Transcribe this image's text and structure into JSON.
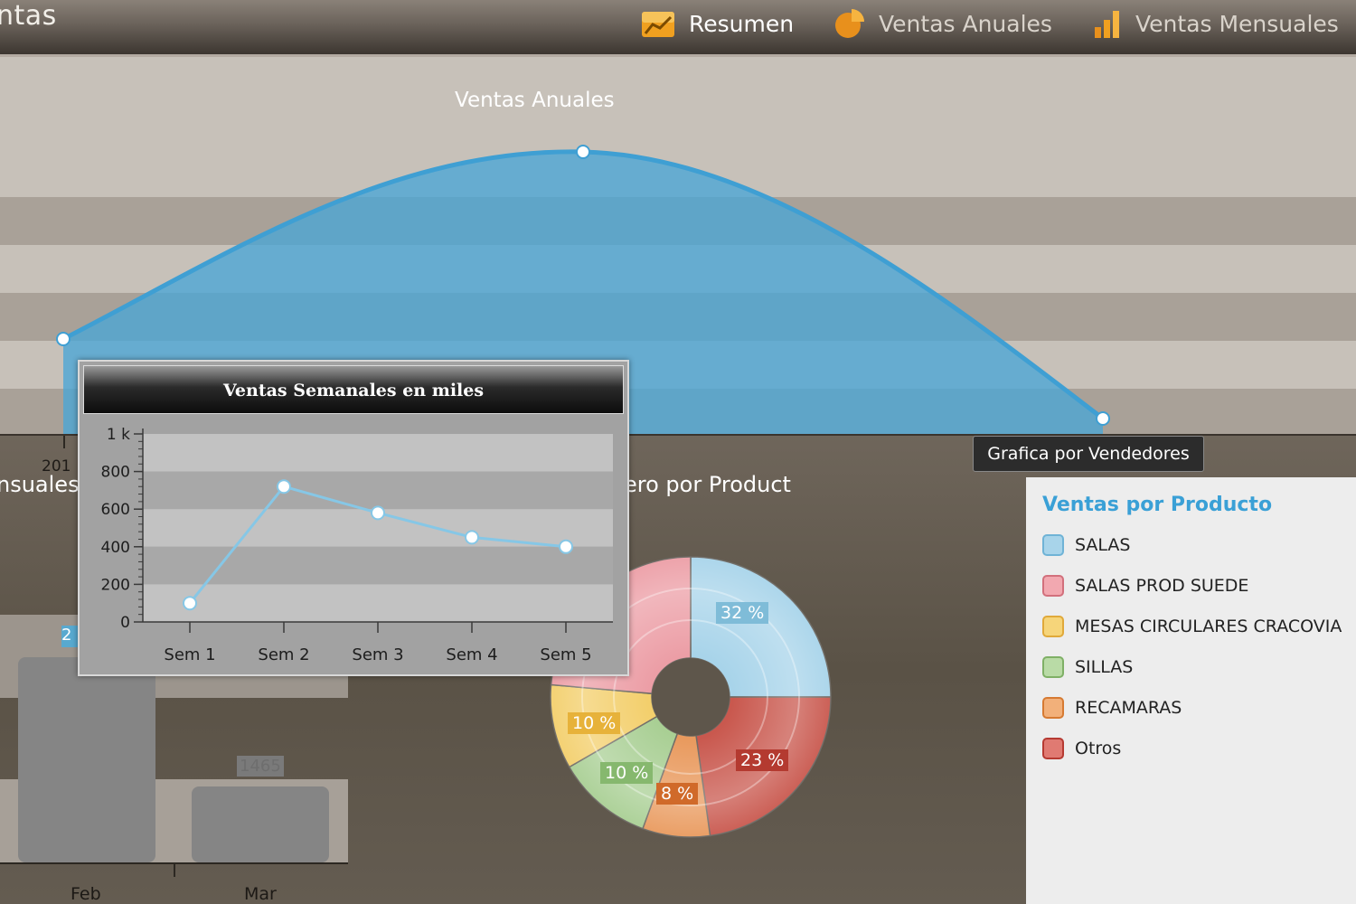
{
  "app": {
    "title_fragment": "ntas"
  },
  "nav": {
    "items": [
      {
        "label": "Resumen",
        "icon": "line-chart-icon",
        "active": true
      },
      {
        "label": "Ventas Anuales",
        "icon": "pie-chart-icon",
        "active": false
      },
      {
        "label": "Ventas Mensuales",
        "icon": "bar-chart-icon",
        "active": false
      }
    ]
  },
  "colors": {
    "accent_orange": "#f0a020",
    "area_blue": "#4aa6d6",
    "legend_title": "#3aa0d6"
  },
  "annual_chart": {
    "title": "Ventas Anuales",
    "year_tick_fragment": "201"
  },
  "partial_titles": {
    "left": "nsuales",
    "center": "ero por Product"
  },
  "monthly_bars": {
    "months": [
      "Feb",
      "Mar"
    ],
    "mar_value_label": "1465",
    "feb_value_label_fragment": "2"
  },
  "tooltip": {
    "text": "Grafica por Vendedores"
  },
  "legend": {
    "title": "Ventas por Producto",
    "items": [
      {
        "label": "SALAS",
        "color": "#a8d4ea",
        "border": "#6fb3d6"
      },
      {
        "label": "SALAS PROD SUEDE",
        "color": "#f2a8b0",
        "border": "#d2707c"
      },
      {
        "label": "MESAS CIRCULARES CRACOVIA",
        "color": "#f6d57a",
        "border": "#e0a93a"
      },
      {
        "label": "SILLAS",
        "color": "#b9dba6",
        "border": "#7fb066"
      },
      {
        "label": "RECAMARAS",
        "color": "#f2b07a",
        "border": "#d67a32"
      },
      {
        "label": "Otros",
        "color": "#e07a72",
        "border": "#b63a32"
      }
    ]
  },
  "donut": {
    "slices": [
      {
        "label": "32 %",
        "color": "#a8d4ea",
        "label_bg": "#7fbcd8"
      },
      {
        "label": "23 %",
        "color": "#c9584e",
        "label_bg": "#b43a30"
      },
      {
        "label": "8 %",
        "color": "#e99a5e",
        "label_bg": "#d06a2a"
      },
      {
        "label": "10 %",
        "color": "#a9cf94",
        "label_bg": "#86b86e"
      },
      {
        "label": "10 %",
        "color": "#f3cf6c",
        "label_bg": "#e7b23a"
      },
      {
        "label": "",
        "color": "#ec9ea6",
        "label_bg": "#d8707a"
      }
    ]
  },
  "weekly_popup": {
    "title": "Ventas Semanales en miles"
  },
  "chart_data": {
    "type": "line",
    "title": "Ventas Semanales en miles",
    "categories": [
      "Sem 1",
      "Sem 2",
      "Sem 3",
      "Sem 4",
      "Sem 5"
    ],
    "values": [
      100,
      720,
      580,
      450,
      400
    ],
    "ylim": [
      0,
      1000
    ],
    "yticks": [
      "0",
      "200",
      "400",
      "600",
      "800",
      "1 k"
    ],
    "grid": true
  }
}
